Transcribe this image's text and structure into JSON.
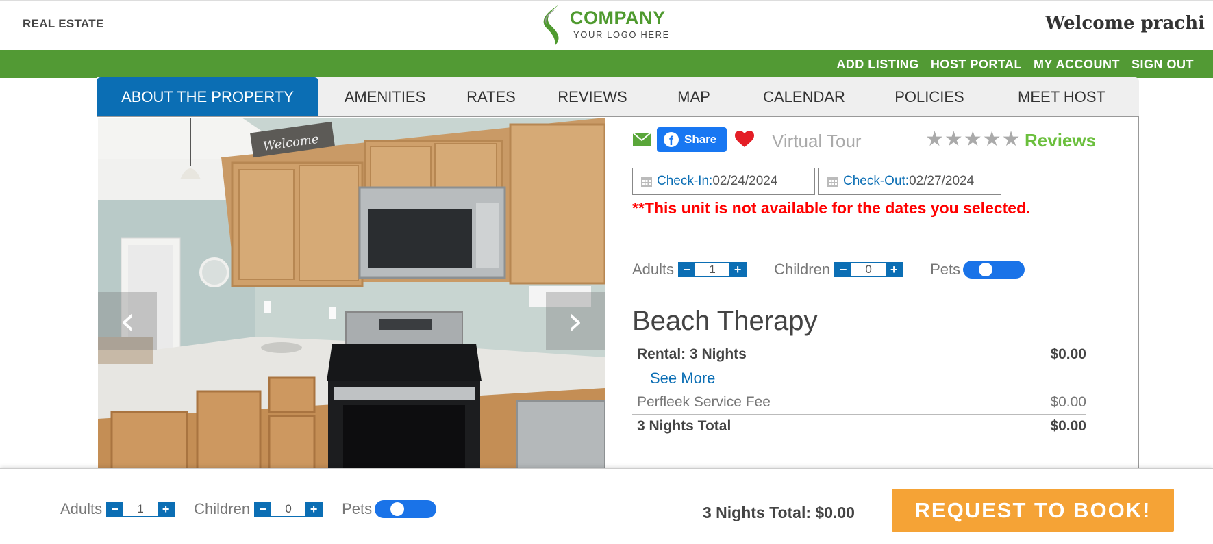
{
  "header": {
    "left_label": "REAL ESTATE",
    "logo_name": "COMPANY",
    "logo_tagline": "YOUR LOGO HERE",
    "welcome": "Welcome prachi"
  },
  "top_nav": {
    "items": [
      "ADD LISTING",
      "HOST PORTAL",
      "MY ACCOUNT",
      "SIGN OUT"
    ]
  },
  "tabs": {
    "items": [
      {
        "label": "ABOUT THE PROPERTY",
        "active": true
      },
      {
        "label": "AMENITIES",
        "active": false
      },
      {
        "label": "RATES",
        "active": false
      },
      {
        "label": "REVIEWS",
        "active": false
      },
      {
        "label": "MAP",
        "active": false
      },
      {
        "label": "CALENDAR",
        "active": false
      },
      {
        "label": "POLICIES",
        "active": false
      },
      {
        "label": "MEET HOST",
        "active": false
      }
    ]
  },
  "gallery": {
    "prev_icon": "chevron-left-icon",
    "next_icon": "chevron-right-icon",
    "welcome_sign": "Welcome"
  },
  "actions": {
    "share_label": "Share",
    "virtual_tour": "Virtual Tour",
    "rating_stars": 5,
    "reviews_label": "Reviews"
  },
  "booking": {
    "checkin_label": "Check-In:",
    "checkin_value": "02/24/2024",
    "checkout_label": "Check-Out:",
    "checkout_value": "02/27/2024",
    "unavailable_msg": "**This unit is not available for the dates you selected.",
    "adults_label": "Adults",
    "adults_value": "1",
    "children_label": "Children",
    "children_value": "0",
    "pets_label": "Pets",
    "minus": "−",
    "plus": "+"
  },
  "property": {
    "title": "Beach Therapy",
    "rental_label": "Rental: 3 Nights",
    "rental_amount": "$0.00",
    "see_more": "See More",
    "fee_label": "Perfleek Service Fee",
    "fee_amount": "$0.00",
    "total_label": "3 Nights Total",
    "total_amount": "$0.00"
  },
  "bottom_bar": {
    "adults_label": "Adults",
    "adults_value": "1",
    "children_label": "Children",
    "children_value": "0",
    "pets_label": "Pets",
    "total_text": "3 Nights Total: $0.00",
    "book_button": "REQUEST TO BOOK!"
  },
  "colors": {
    "brand_green": "#529a34",
    "tab_blue": "#0b6eb4",
    "facebook_blue": "#1877f2",
    "alert_red": "#ff0000",
    "book_orange": "#f5a336",
    "reviews_green": "#6bbf3d"
  }
}
